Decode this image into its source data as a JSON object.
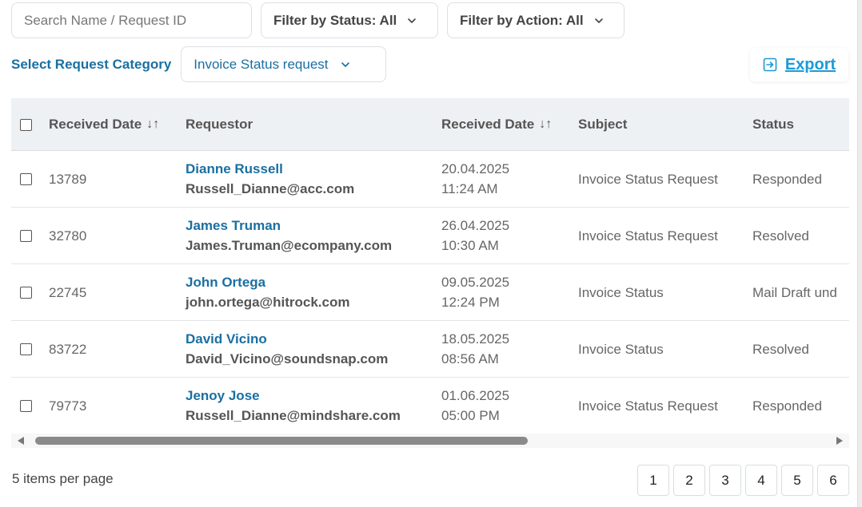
{
  "filters": {
    "search_placeholder": "Search Name / Request ID",
    "status_label": "Filter by Status: All",
    "action_label": "Filter by Action: All"
  },
  "category": {
    "label": "Select Request Category",
    "selected": "Invoice Status request"
  },
  "export": {
    "label": "Export"
  },
  "table": {
    "headers": {
      "col1": "Received Date",
      "col2": "Requestor",
      "col3": "Received Date",
      "col4": "Subject",
      "col5": "Status"
    },
    "rows": [
      {
        "id": "13789",
        "name": "Dianne Russell",
        "email": "Russell_Dianne@acc.com",
        "date": "20.04.2025",
        "time": "11:24 AM",
        "subject": "Invoice Status Request",
        "status": "Responded"
      },
      {
        "id": "32780",
        "name": "James Truman",
        "email": "James.Truman@ecompany.com",
        "date": "26.04.2025",
        "time": "10:30 AM",
        "subject": "Invoice Status Request",
        "status": "Resolved"
      },
      {
        "id": "22745",
        "name": "John Ortega",
        "email": "john.ortega@hitrock.com",
        "date": "09.05.2025",
        "time": "12:24 PM",
        "subject": "Invoice Status",
        "status": "Mail Draft und"
      },
      {
        "id": "83722",
        "name": "David Vicino",
        "email": "David_Vicino@soundsnap.com",
        "date": "18.05.2025",
        "time": "08:56 AM",
        "subject": "Invoice Status",
        "status": "Resolved"
      },
      {
        "id": "79773",
        "name": "Jenoy Jose",
        "email": "Russell_Dianne@mindshare.com",
        "date": "01.06.2025",
        "time": "05:00 PM",
        "subject": "Invoice Status Request",
        "status": "Responded"
      }
    ]
  },
  "footer": {
    "per_page": "5 items per page",
    "pages": [
      "1",
      "2",
      "3",
      "4",
      "5",
      "6"
    ]
  },
  "icons": {
    "sort": "sort-icon",
    "chevron": "chevron-down-icon",
    "export": "export-icon"
  },
  "colors": {
    "accent": "#1a6fa1",
    "link": "#1d9ad6",
    "header_bg": "#eef1f4"
  }
}
